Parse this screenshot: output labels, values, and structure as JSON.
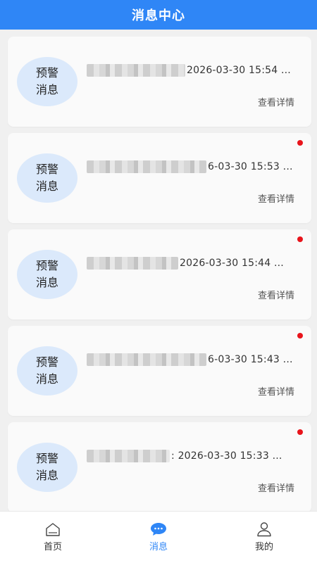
{
  "header": {
    "title": "消息中心"
  },
  "messages": [
    {
      "badge_line1": "预警",
      "badge_line2": "消息",
      "time": "2026-03-30 15:54 ...",
      "detail_label": "查看详情",
      "unread": false
    },
    {
      "badge_line1": "预警",
      "badge_line2": "消息",
      "time": "6-03-30 15:53 ...",
      "detail_label": "查看详情",
      "unread": true
    },
    {
      "badge_line1": "预警",
      "badge_line2": "消息",
      "time": "2026-03-30 15:44 ...",
      "detail_label": "查看详情",
      "unread": true
    },
    {
      "badge_line1": "预警",
      "badge_line2": "消息",
      "time": "6-03-30 15:43 ...",
      "detail_label": "查看详情",
      "unread": true
    },
    {
      "badge_line1": "预警",
      "badge_line2": "消息",
      "time": ": 2026-03-30 15:33 ...",
      "detail_label": "查看详情",
      "unread": true
    }
  ],
  "tabbar": {
    "items": [
      {
        "label": "首页",
        "icon": "home-icon",
        "active": false
      },
      {
        "label": "消息",
        "icon": "message-icon",
        "active": true
      },
      {
        "label": "我的",
        "icon": "profile-icon",
        "active": false
      }
    ]
  },
  "colors": {
    "accent": "#2f86f6",
    "badge_bg": "#dbe9fb",
    "unread_dot": "#e8141b",
    "page_bg": "#f0f0f0"
  }
}
